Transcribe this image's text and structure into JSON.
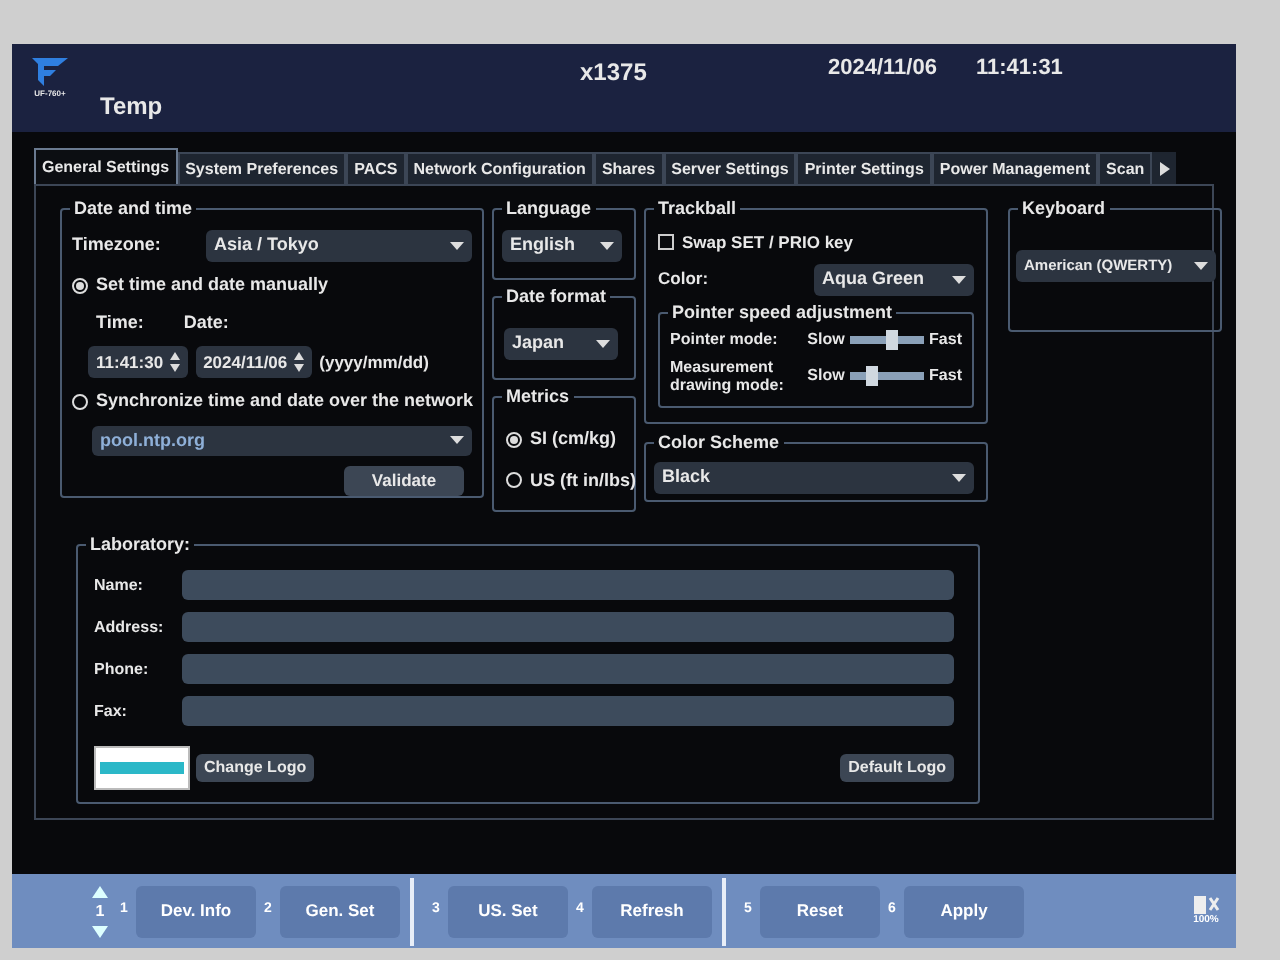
{
  "header": {
    "logo_caption": "UF-760+",
    "title": "Temp",
    "zoom": "x1375",
    "date": "2024/11/06",
    "time": "11:41:31"
  },
  "tabs": [
    {
      "label": "General Settings",
      "selected": true
    },
    {
      "label": "System Preferences",
      "selected": false
    },
    {
      "label": "PACS",
      "selected": false
    },
    {
      "label": "Network Configuration",
      "selected": false
    },
    {
      "label": "Shares",
      "selected": false
    },
    {
      "label": "Server Settings",
      "selected": false
    },
    {
      "label": "Printer Settings",
      "selected": false
    },
    {
      "label": "Power Management",
      "selected": false
    },
    {
      "label": "Scan",
      "selected": false
    }
  ],
  "date_time": {
    "title": "Date and time",
    "timezone_label": "Timezone:",
    "timezone": "Asia / Tokyo",
    "modes": [
      {
        "label": "Set time and date manually",
        "selected": true
      },
      {
        "label": "Synchronize time and date over the network",
        "selected": false
      }
    ],
    "time_label": "Time:",
    "date_label": "Date:",
    "time": "11:41:30",
    "date": "2024/11/06",
    "date_hint": "(yyyy/mm/dd)",
    "ntp_server": "pool.ntp.org",
    "validate": "Validate"
  },
  "language": {
    "title": "Language",
    "value": "English"
  },
  "date_format": {
    "title": "Date format",
    "value": "Japan"
  },
  "metrics": {
    "title": "Metrics",
    "options": [
      {
        "label": "SI (cm/kg)",
        "selected": true
      },
      {
        "label": "US (ft in/lbs)",
        "selected": false
      }
    ]
  },
  "trackball": {
    "title": "Trackball",
    "swap": {
      "label": "Swap SET / PRIO key",
      "checked": false
    },
    "color_label": "Color:",
    "color_value": "Aqua Green",
    "pointer_speed": {
      "title": "Pointer speed adjustment",
      "sliders": [
        {
          "label": "Pointer mode:",
          "slow": "Slow",
          "fast": "Fast",
          "level": 0.55
        },
        {
          "label": "Measurement drawing mode:",
          "slow": "Slow",
          "fast": "Fast",
          "level": 0.25
        }
      ]
    }
  },
  "color_scheme": {
    "title": "Color Scheme",
    "value": "Black"
  },
  "keyboard": {
    "title": "Keyboard",
    "value": "American (QWERTY)"
  },
  "laboratory": {
    "title": "Laboratory:",
    "fields": [
      {
        "label": "Name:"
      },
      {
        "label": "Address:"
      },
      {
        "label": "Phone:"
      },
      {
        "label": "Fax:"
      }
    ],
    "change_logo": "Change Logo",
    "default_logo": "Default Logo"
  },
  "bottom_bar": {
    "page": "1",
    "groups": [
      [
        {
          "number": "1",
          "label": "Dev. Info"
        },
        {
          "number": "2",
          "label": "Gen. Set"
        }
      ],
      [
        {
          "number": "3",
          "label": "US. Set"
        },
        {
          "number": "4",
          "label": "Refresh"
        }
      ],
      [
        {
          "number": "5",
          "label": "Reset"
        },
        {
          "number": "6",
          "label": "Apply"
        }
      ]
    ],
    "battery": "100%"
  }
}
